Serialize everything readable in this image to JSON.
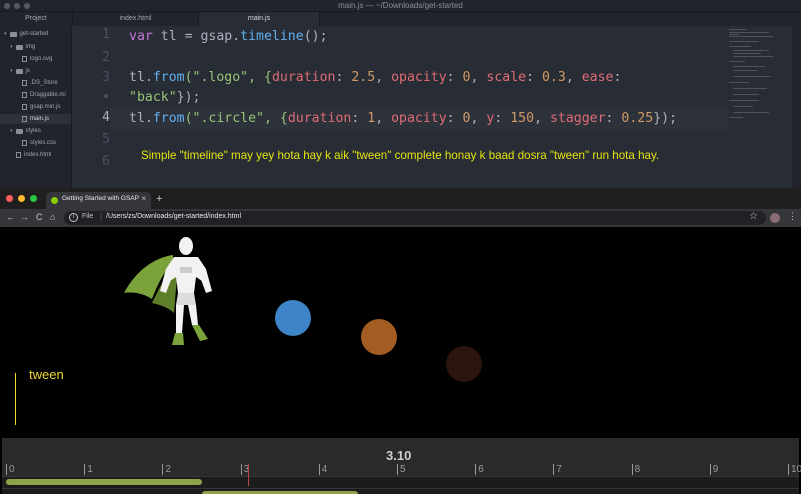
{
  "editor": {
    "title": "main.js — ~/Downloads/get-started",
    "tabs": {
      "project": "Project",
      "index": "index.html",
      "main": "main.js"
    },
    "tree": [
      {
        "label": "get-started",
        "kind": "folder",
        "depth": 0
      },
      {
        "label": "img",
        "kind": "folder",
        "depth": 1
      },
      {
        "label": "logo.svg",
        "kind": "file",
        "depth": 2
      },
      {
        "label": "js",
        "kind": "folder",
        "depth": 1
      },
      {
        "label": ".DS_Store",
        "kind": "file",
        "depth": 2
      },
      {
        "label": "Draggable.mi",
        "kind": "file",
        "depth": 2
      },
      {
        "label": "gsap.min.js",
        "kind": "file",
        "depth": 2
      },
      {
        "label": "main.js",
        "kind": "file",
        "depth": 2,
        "selected": true
      },
      {
        "label": "styles",
        "kind": "folder",
        "depth": 1
      },
      {
        "label": "styles.css",
        "kind": "file",
        "depth": 2
      },
      {
        "label": "index.html",
        "kind": "file",
        "depth": 1
      }
    ],
    "line_numbers": [
      "1",
      "2",
      "3",
      "•",
      "4",
      "5",
      "6"
    ],
    "active_line": "4",
    "code": {
      "l1": {
        "a": "var",
        "b": " tl = gsap.",
        "c": "timeline",
        "d": "();"
      },
      "l3": {
        "a": "tl.",
        "b": "from",
        "c": "(\".logo\", {",
        "d": "duration",
        "e": ": ",
        "f": "2.5",
        "g": ", ",
        "h": "opacity",
        "i": ": ",
        "j": "0",
        "k": ", ",
        "l": "scale",
        "m": ": ",
        "n": "0.3",
        "o": ", ",
        "p": "ease",
        "q": ":"
      },
      "l3b": {
        "a": "\"back\"",
        "b": "});"
      },
      "l4": {
        "a": "tl.",
        "b": "from",
        "c": "(\".circle\", {",
        "d": "duration",
        "e": ": ",
        "f": "1",
        "g": ", ",
        "h": "opacity",
        "i": ": ",
        "j": "0",
        "k": ", ",
        "l": "y",
        "m": ": ",
        "n": "150",
        "o": ", ",
        "p": "stagger",
        "q": ": ",
        "r": "0.25",
        "s": "});"
      }
    },
    "note": "Simple \"timeline\" may yey hota hay k aik \"tween\" complete honay k baad dosra \"tween\" run hota hay."
  },
  "browser": {
    "tab_title": "Getting Started with GSAP",
    "close_glyph": "×",
    "new_tab_glyph": "+",
    "nav": {
      "back": "←",
      "forward": "→",
      "reload": "C",
      "home": "⌂"
    },
    "url_scheme": "File",
    "url_sep": "|",
    "url_path": "/Users/zs/Downloads/get-started/index.html",
    "star_glyph": "☆",
    "menu_glyph": "⋮",
    "traffic_colors": [
      "#ff5f57",
      "#febc2e",
      "#28c840"
    ],
    "circle_colors": [
      "#3d85c6",
      "#a35c22",
      "#2d150f"
    ]
  },
  "annotations": {
    "top": "tween",
    "bottom": "tween"
  },
  "gsdevtools": {
    "time": "3.10",
    "ticks": [
      "0",
      "1",
      "2",
      "3",
      "4",
      "5",
      "6",
      "7",
      "8",
      "9",
      "10"
    ],
    "timeline_end": 10,
    "playhead_time": 3.1,
    "tweens": [
      {
        "start": 0,
        "end": 2.5
      },
      {
        "start": 2.5,
        "end": 4.5
      }
    ]
  }
}
